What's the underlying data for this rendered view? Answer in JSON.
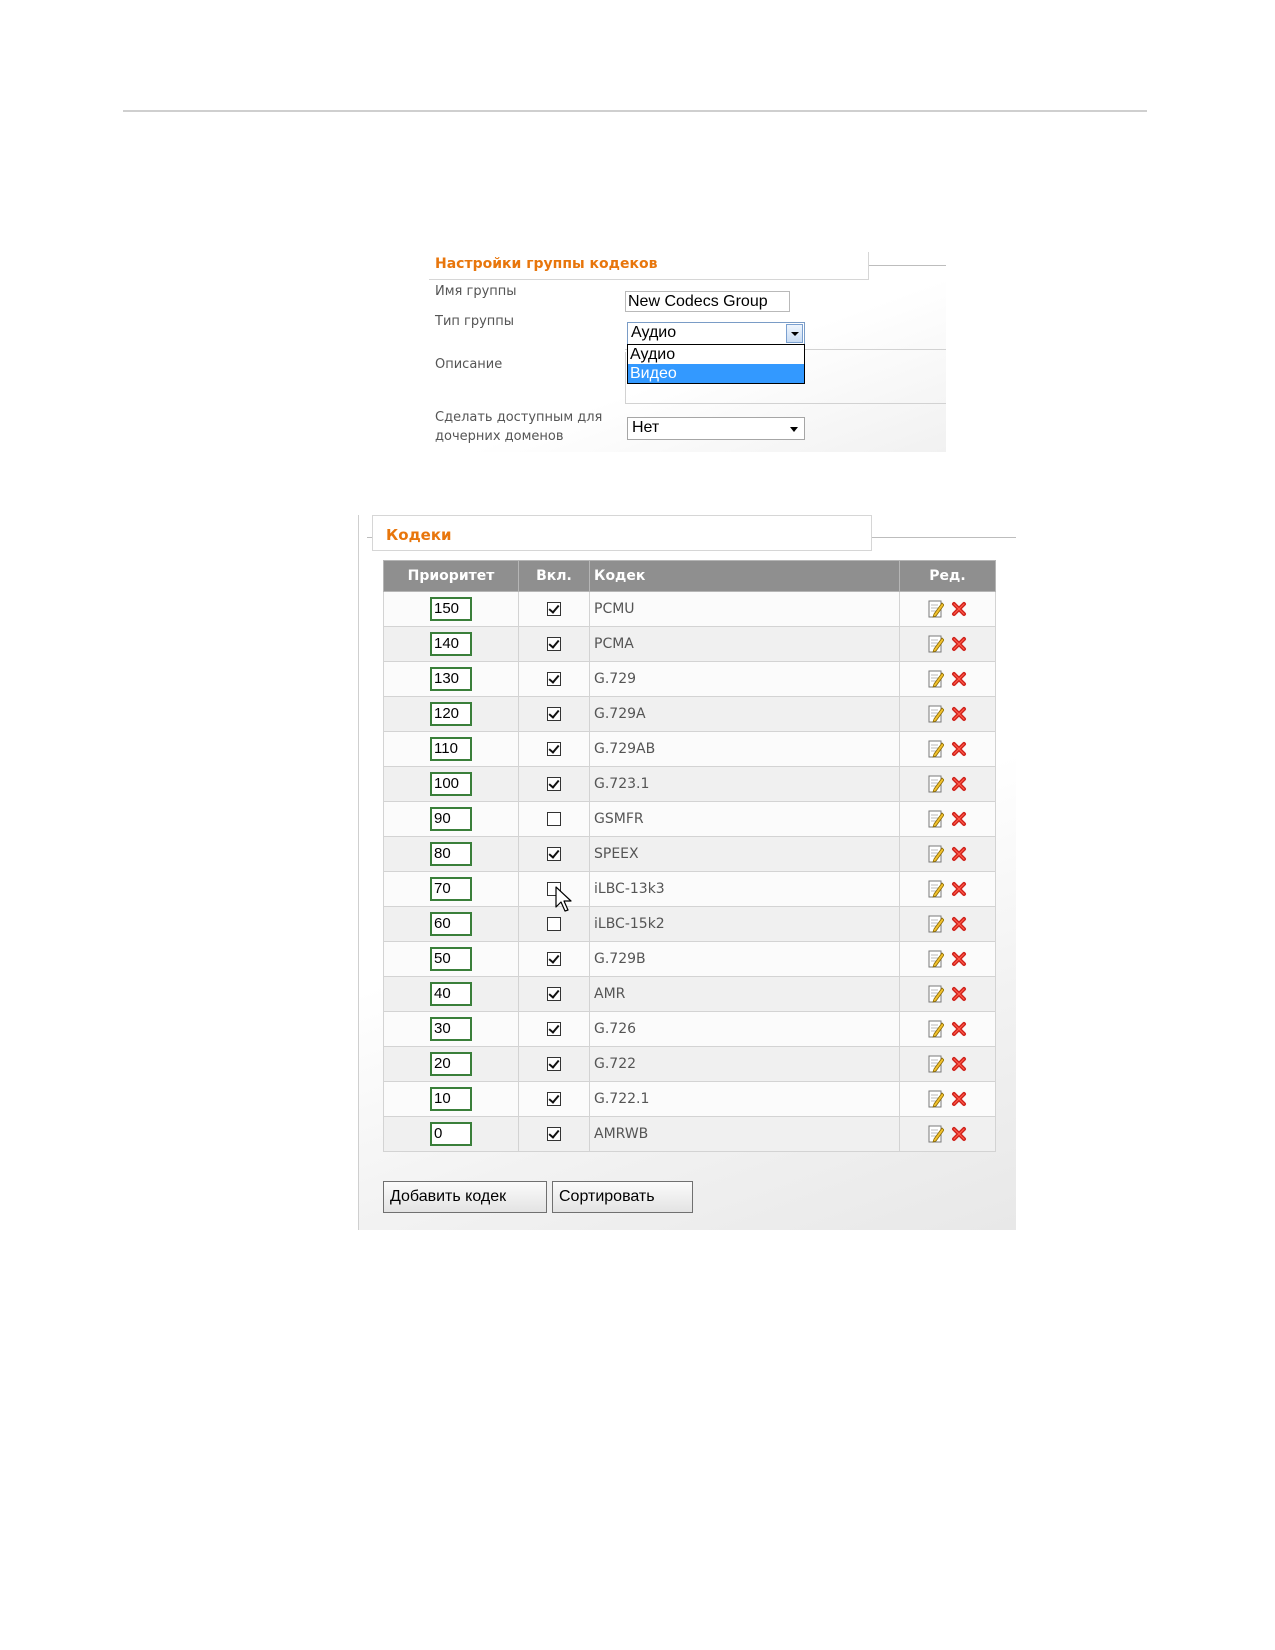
{
  "group_settings": {
    "title": "Настройки группы кодеков",
    "name_label": "Имя группы",
    "name_value": "New Codecs Group",
    "type_label": "Тип группы",
    "type_value": "Аудио",
    "type_options": [
      "Аудио",
      "Видео"
    ],
    "type_highlighted": "Видео",
    "description_label": "Описание",
    "share_label_line1": "Сделать доступным для",
    "share_label_line2": "дочерних доменов",
    "share_value": "Нет"
  },
  "codecs": {
    "title": "Кодеки",
    "columns": [
      "Приоритет",
      "Вкл.",
      "Кодек",
      "Ред."
    ],
    "rows": [
      {
        "priority": "150",
        "enabled": true,
        "codec": "PCMU"
      },
      {
        "priority": "140",
        "enabled": true,
        "codec": "PCMA"
      },
      {
        "priority": "130",
        "enabled": true,
        "codec": "G.729"
      },
      {
        "priority": "120",
        "enabled": true,
        "codec": "G.729A"
      },
      {
        "priority": "110",
        "enabled": true,
        "codec": "G.729AB"
      },
      {
        "priority": "100",
        "enabled": true,
        "codec": "G.723.1"
      },
      {
        "priority": "90",
        "enabled": false,
        "codec": "GSMFR"
      },
      {
        "priority": "80",
        "enabled": true,
        "codec": "SPEEX"
      },
      {
        "priority": "70",
        "enabled": false,
        "codec": "iLBC-13k3"
      },
      {
        "priority": "60",
        "enabled": false,
        "codec": "iLBC-15k2"
      },
      {
        "priority": "50",
        "enabled": true,
        "codec": "G.729B"
      },
      {
        "priority": "40",
        "enabled": true,
        "codec": "AMR"
      },
      {
        "priority": "30",
        "enabled": true,
        "codec": "G.726"
      },
      {
        "priority": "20",
        "enabled": true,
        "codec": "G.722"
      },
      {
        "priority": "10",
        "enabled": true,
        "codec": "G.722.1"
      },
      {
        "priority": "0",
        "enabled": true,
        "codec": "AMRWB"
      }
    ],
    "add_button": "Добавить кодек",
    "sort_button": "Сортировать"
  },
  "icons": {
    "edit": "edit-icon",
    "delete": "delete-icon",
    "cursor": "mouse-pointer-icon"
  },
  "colors": {
    "accent": "#e8760c",
    "header_bg": "#8f8f8f",
    "selection": "#3399ff",
    "delete_red": "#d0221c"
  }
}
